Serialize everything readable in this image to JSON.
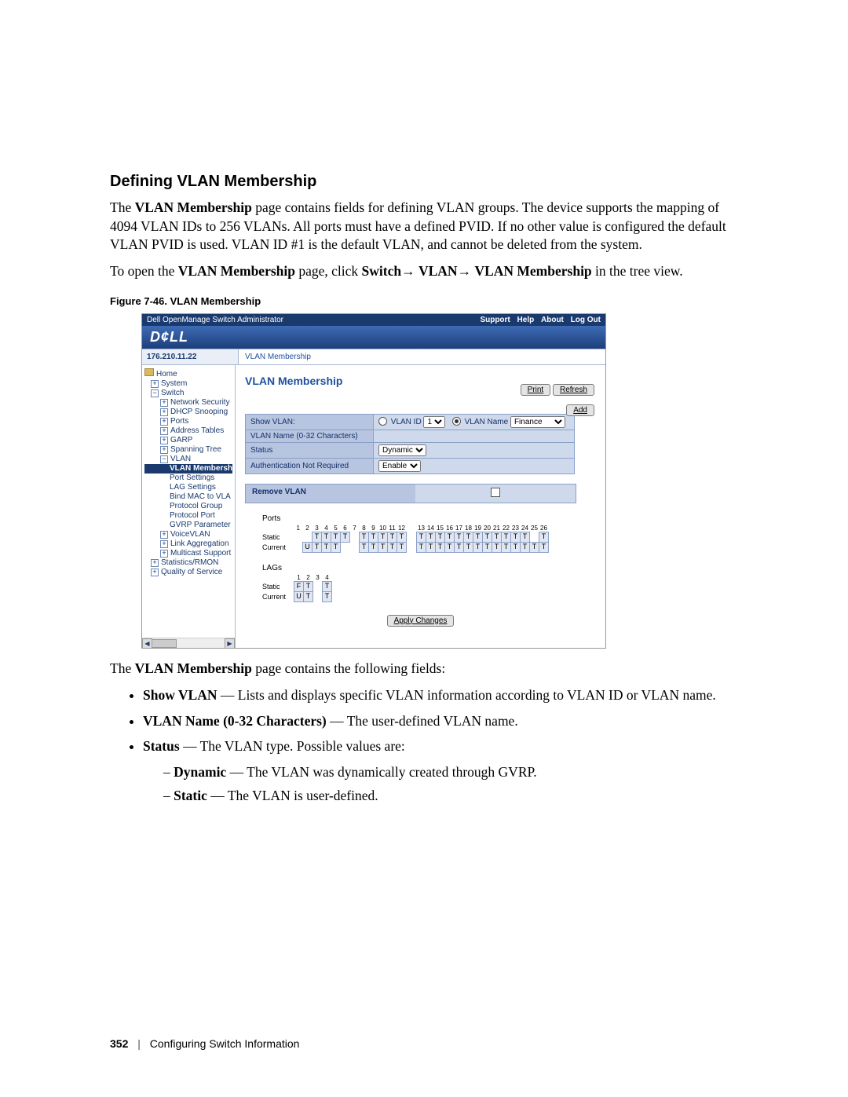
{
  "heading": "Defining VLAN Membership",
  "para1_a": "The ",
  "para1_b": "VLAN Membership",
  "para1_c": " page contains fields for defining VLAN groups. The device supports the mapping of 4094 VLAN IDs to 256 VLANs. All ports must have a defined PVID. If no other value is configured the default VLAN PVID is used. VLAN ID #1 is the default VLAN, and cannot be deleted from the system.",
  "para2_a": "To open the ",
  "para2_b": "VLAN Membership",
  "para2_c": " page, click ",
  "para2_d": "Switch",
  "para2_e": "→ ",
  "para2_f": "VLAN",
  "para2_g": "→ ",
  "para2_h": "VLAN Membership",
  "para2_i": " in the tree view.",
  "fig_caption": "Figure 7-46.    VLAN Membership",
  "post_a": "The ",
  "post_b": "VLAN Membership",
  "post_c": " page contains the following fields:",
  "bullets": {
    "b1_a": "Show VLAN",
    "b1_b": " — Lists and displays specific VLAN information according to VLAN ID or VLAN name.",
    "b2_a": "VLAN Name (0-32 Characters)",
    "b2_b": " — The user-defined VLAN name.",
    "b3_a": "Status",
    "b3_b": " — The VLAN type. Possible values are:",
    "d1_a": "Dynamic",
    "d1_b": " — The VLAN was dynamically created through GVRP.",
    "d2_a": "Static",
    "d2_b": " — The VLAN is user-defined."
  },
  "footer": {
    "page": "352",
    "section": "Configuring Switch Information"
  },
  "shot": {
    "title": "Dell OpenManage Switch Administrator",
    "links": {
      "support": "Support",
      "help": "Help",
      "about": "About",
      "logout": "Log Out"
    },
    "brand": "D¢LL",
    "ip": "176.210.11.22",
    "crumb": "VLAN Membership",
    "tree": {
      "home": "Home",
      "system": "System",
      "switch": "Switch",
      "nsec": "Network Security",
      "dhcp": "DHCP Snooping",
      "ports": "Ports",
      "addr": "Address Tables",
      "garp": "GARP",
      "span": "Spanning Tree",
      "vlan": "VLAN",
      "vlan_mem": "VLAN Membersh",
      "port_set": "Port Settings",
      "lag_set": "LAG Settings",
      "bind": "Bind MAC to VLA",
      "pgroup": "Protocol Group",
      "pport": "Protocol Port",
      "gvrp": "GVRP Parameter",
      "voice": "VoiceVLAN",
      "linkagg": "Link Aggregation",
      "multi": "Multicast Support",
      "stats": "Statistics/RMON",
      "qos": "Quality of Service"
    },
    "content": {
      "heading": "VLAN Membership",
      "print": "Print",
      "refresh": "Refresh",
      "add": "Add",
      "form": {
        "show_vlan": "Show VLAN:",
        "vlan_id_lbl": "VLAN ID",
        "vlan_id_val": "1",
        "vlan_name_lbl": "VLAN Name",
        "vlan_name_val": "Finance",
        "vlan_name_row": "VLAN Name (0-32 Characters)",
        "status": "Status",
        "status_val": "Dynamic",
        "auth": "Authentication Not Required",
        "auth_val": "Enable"
      },
      "remove": "Remove VLAN",
      "ports_title": "Ports",
      "row_static": "Static",
      "row_current": "Current",
      "lags_title": "LAGs",
      "apply": "Apply Changes",
      "port_nums": [
        "1",
        "2",
        "3",
        "4",
        "5",
        "6",
        "7",
        "8",
        "9",
        "10",
        "11",
        "12",
        "13",
        "14",
        "15",
        "16",
        "17",
        "18",
        "19",
        "20",
        "21",
        "22",
        "23",
        "24",
        "25",
        "26"
      ],
      "lag_nums": [
        "1",
        "2",
        "3",
        "4"
      ],
      "ports_static": [
        "",
        "",
        "T",
        "T",
        "T",
        "T",
        "",
        "T",
        "T",
        "T",
        "T",
        "T",
        "",
        "T",
        "T",
        "T",
        "T",
        "T",
        "T",
        "T",
        "T",
        "T",
        "T",
        "T",
        "T",
        "",
        "T"
      ],
      "ports_current": [
        "",
        "U",
        "T",
        "T",
        "T",
        "",
        "",
        "T",
        "T",
        "T",
        "T",
        "T",
        "",
        "T",
        "T",
        "T",
        "T",
        "T",
        "T",
        "T",
        "T",
        "T",
        "T",
        "T",
        "T",
        "T",
        "T"
      ],
      "lags_static": [
        "F",
        "T",
        "",
        "T"
      ],
      "lags_current": [
        "U",
        "T",
        "",
        "T"
      ]
    }
  }
}
